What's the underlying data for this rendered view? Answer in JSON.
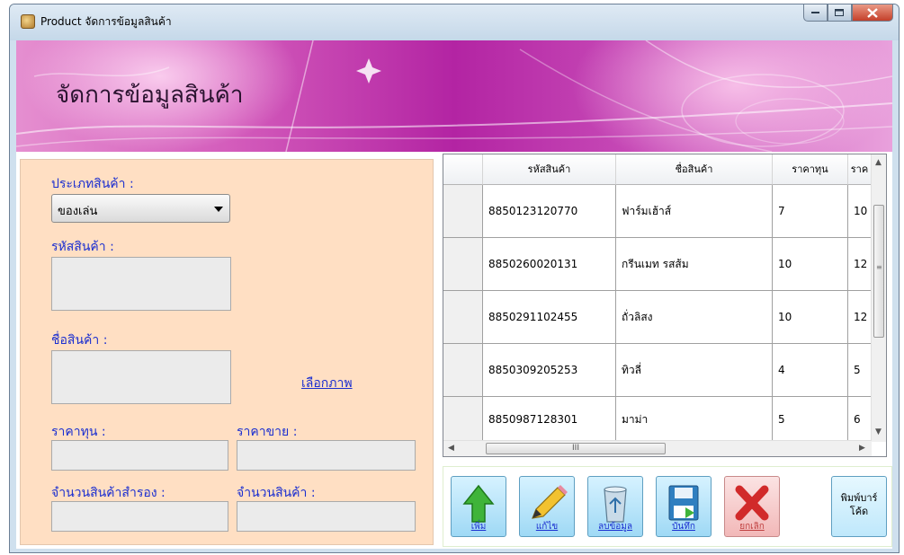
{
  "window": {
    "title": "Product จัดการข้อมูลสินค้า",
    "controls": [
      "minimize",
      "maximize",
      "close"
    ]
  },
  "banner": {
    "title": "จัดการข้อมูลสินค้า"
  },
  "form": {
    "category_label": "ประเภทสินค้า :",
    "category_value": "ของเล่น",
    "product_id_label": "รหัสสินค้า :",
    "product_id_value": "",
    "product_name_label": "ชื่อสินค้า :",
    "product_name_value": "",
    "choose_image_link": "เลือกภาพ",
    "cost_label": "ราคาทุน :",
    "cost_value": "",
    "price_label": "ราคาขาย :",
    "price_value": "",
    "reserve_qty_label": "จำนวนสินค้าสำรอง :",
    "reserve_qty_value": "",
    "qty_label": "จำนวนสินค้า :",
    "qty_value": ""
  },
  "grid": {
    "columns": [
      "รหัสสินค้า",
      "ชื่อสินค้า",
      "ราคาทุน",
      "ราค"
    ],
    "rows": [
      [
        "8850123120770",
        "ฟาร์มเฮ้าส์",
        "7",
        "10"
      ],
      [
        "8850260020131",
        "กรีนเมท รสส้ม",
        "10",
        "12"
      ],
      [
        "8850291102455",
        "ถั่วลิสง",
        "10",
        "12"
      ],
      [
        "8850309205253",
        "ทิวลี่",
        "4",
        "5"
      ],
      [
        "8850987128301",
        "มาม่า",
        "5",
        "6"
      ]
    ],
    "hscroll_label": "III"
  },
  "toolbar": {
    "add_label": "เพิ่ม",
    "edit_label": "แก้ไข",
    "delete_label": "ลบข้อมูล",
    "save_label": "บันทึก",
    "cancel_label": "ยกเลิก",
    "print_label_line1": "พิมพ์บาร์",
    "print_label_line2": "โค้ด"
  },
  "icons": {
    "add": "green-up-arrow-icon",
    "edit": "pencil-icon",
    "delete": "recycle-bin-icon",
    "save": "floppy-disk-icon",
    "cancel": "red-x-icon"
  },
  "colors": {
    "form_background": "#ffdfc3",
    "label_blue": "#1b2fd0",
    "banner_magenta": "#b324a3",
    "button_blue": "#9fd9f5"
  }
}
